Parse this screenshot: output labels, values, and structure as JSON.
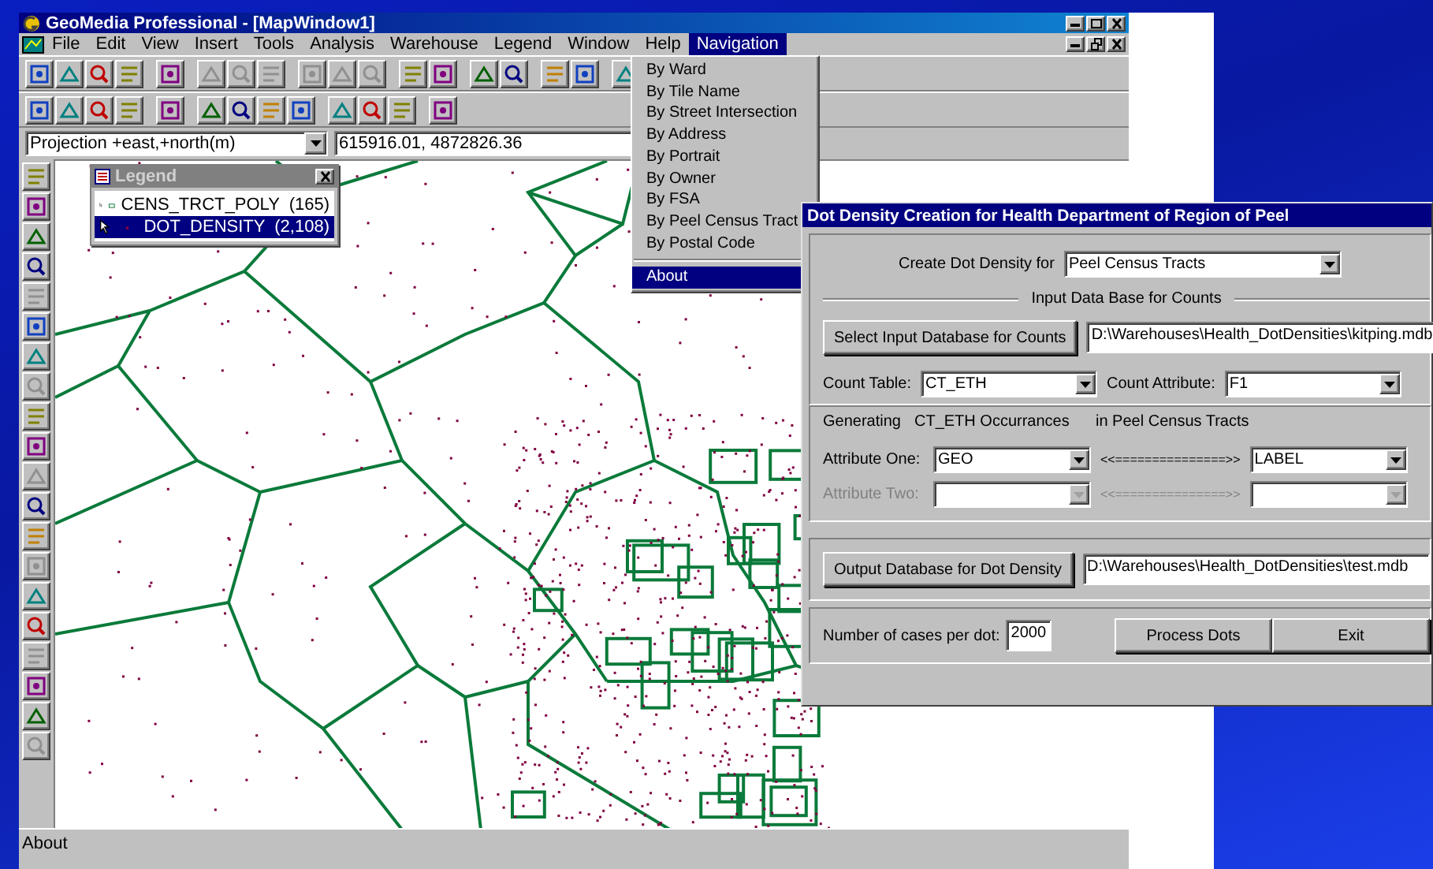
{
  "window": {
    "title": "GeoMedia Professional - [MapWindow1]"
  },
  "menu_bar": [
    {
      "label": "File",
      "selected": false
    },
    {
      "label": "Edit",
      "selected": false
    },
    {
      "label": "View",
      "selected": false
    },
    {
      "label": "Insert",
      "selected": false
    },
    {
      "label": "Tools",
      "selected": false
    },
    {
      "label": "Analysis",
      "selected": false
    },
    {
      "label": "Warehouse",
      "selected": false
    },
    {
      "label": "Legend",
      "selected": false
    },
    {
      "label": "Window",
      "selected": false
    },
    {
      "label": "Help",
      "selected": false
    },
    {
      "label": "Navigation",
      "selected": true
    }
  ],
  "navigation_menu": [
    {
      "kind": "item",
      "label": "By Ward",
      "selected": false
    },
    {
      "kind": "item",
      "label": "By Tile Name",
      "selected": false
    },
    {
      "kind": "item",
      "label": "By Street Intersection",
      "selected": false
    },
    {
      "kind": "item",
      "label": "By Address",
      "selected": false
    },
    {
      "kind": "item",
      "label": "By Portrait",
      "selected": false
    },
    {
      "kind": "item",
      "label": "By Owner",
      "selected": false
    },
    {
      "kind": "item",
      "label": "By FSA",
      "selected": false
    },
    {
      "kind": "item",
      "label": "By Peel Census Tract",
      "selected": false
    },
    {
      "kind": "item",
      "label": "By Postal Code",
      "selected": false
    },
    {
      "kind": "separator"
    },
    {
      "kind": "item",
      "label": "About",
      "selected": true
    }
  ],
  "coordinate_bar": {
    "projection": "Projection +east,+north(m)",
    "coordinates": "615916.01, 4872826.36"
  },
  "legend": {
    "title": "Legend",
    "entries": [
      {
        "kind": "area",
        "label": "CENS_TRCT_POLY",
        "count": "(165)",
        "selected": false
      },
      {
        "kind": "point",
        "label": "DOT_DENSITY",
        "count": "(2,108)",
        "selected": true
      }
    ]
  },
  "status_bar": {
    "text": "About"
  },
  "dialog": {
    "title": "Dot Density Creation for Health Department of Region of Peel",
    "create_for": {
      "label": "Create Dot Density for",
      "value": "Peel Census Tracts"
    },
    "input_section": "Input Data Base for Counts",
    "select_button": "Select Input Database for Counts",
    "input_path": "D:\\Warehouses\\Health_DotDensities\\kitping.mdb",
    "count_table": {
      "label": "Count Table:",
      "value": "CT_ETH"
    },
    "count_attribute": {
      "label": "Count Attribute:",
      "value": "F1"
    },
    "generating": [
      "Generating",
      "CT_ETH Occurrances",
      "in Peel Census Tracts"
    ],
    "attributes": [
      {
        "label": "Attribute One:",
        "value": "GEO",
        "link": "<<===============>>",
        "target": "LABEL",
        "disabled": false
      },
      {
        "label": "Attribute Two:",
        "link": "<<===============>>",
        "disabled": true
      }
    ],
    "output_button": "Output Database for Dot Density",
    "output_path": "D:\\Warehouses\\Health_DotDensities\\test.mdb",
    "cases": {
      "label": "Number of cases per dot:",
      "value": "2000"
    },
    "buttons": [
      "Process Dots",
      "Exit"
    ]
  }
}
